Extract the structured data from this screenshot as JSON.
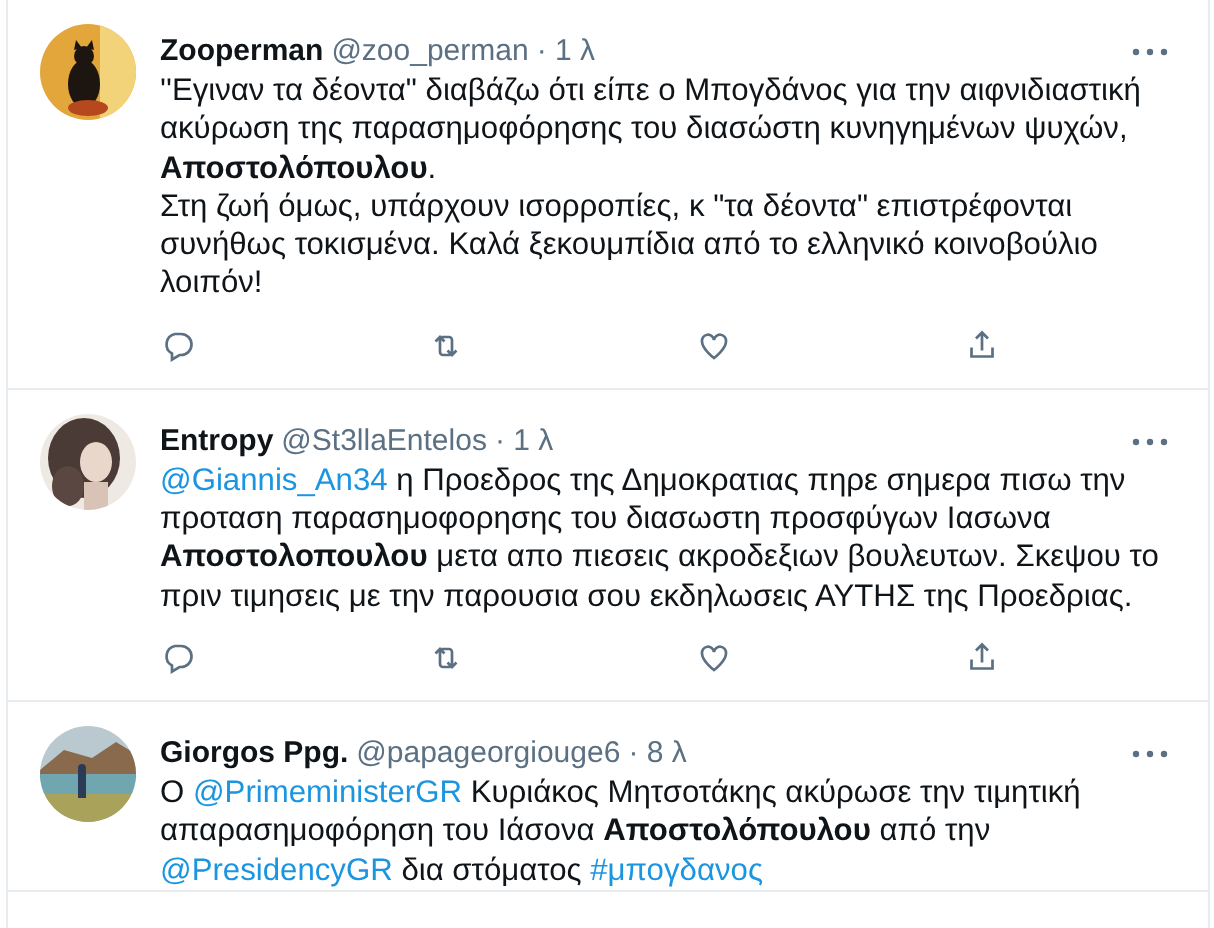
{
  "tweets": [
    {
      "name": "Zooperman",
      "handle": "@zoo_perman",
      "time": "· 1 λ",
      "actions_visible": true,
      "body": [
        {
          "kind": "text",
          "text": "''Εγιναν τα δέοντα\" διαβάζω ότι είπε ο Μπογδάνος για την αιφνιδιαστική ακύρωση της παρασημοφόρησης του διασώστη κυνηγημένων ψυχών, "
        },
        {
          "kind": "bold",
          "text": "Αποστολόπουλου"
        },
        {
          "kind": "text",
          "text": ".\nΣτη ζωή όμως, υπάρχουν ισορροπίες, κ \"τα δέοντα\" επιστρέφονται συνήθως τοκισμένα. Καλά ξεκουμπίδια από το ελληνικό κοινοβούλιο λοιπόν!"
        }
      ]
    },
    {
      "name": "Entropy",
      "handle": "@St3llaEntelos",
      "time": "· 1 λ",
      "actions_visible": true,
      "body": [
        {
          "kind": "mention",
          "text": "@Giannis_An34"
        },
        {
          "kind": "text",
          "text": " η Προεδρος της Δημοκρατιας πηρε σημερα πισω την προταση παρασημοφορησης του διασωστη προσφύγων Ιασωνα "
        },
        {
          "kind": "bold",
          "text": "Αποστολοπουλου"
        },
        {
          "kind": "text",
          "text": " μετα απο πιεσεις ακροδεξιων βουλευτων. Σκεψου το πριν τιμησεις με την παρουσια σου εκδηλωσεις ΑΥΤΗΣ της Προεδριας."
        }
      ]
    },
    {
      "name": "Giorgos Ppg.",
      "handle": "@papageorgiouge6",
      "time": "· 8 λ",
      "actions_visible": false,
      "body": [
        {
          "kind": "text",
          "text": "Ο "
        },
        {
          "kind": "mention",
          "text": "@PrimeministerGR"
        },
        {
          "kind": "text",
          "text": " Κυριάκος Μητσοτάκης ακύρωσε την τιμητική απαρασημοφόρηση του Ιάσονα "
        },
        {
          "kind": "bold",
          "text": "Αποστολόπουλου"
        },
        {
          "kind": "text",
          "text": " από την "
        },
        {
          "kind": "mention",
          "text": "@PresidencyGR"
        },
        {
          "kind": "text",
          "text": " δια στόματος "
        },
        {
          "kind": "hashtag",
          "text": "#μπογδανος"
        }
      ]
    }
  ]
}
